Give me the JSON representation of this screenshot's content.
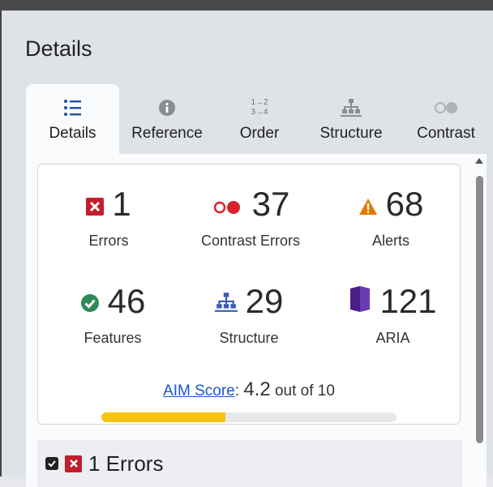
{
  "panel": {
    "title": "Details"
  },
  "tabs": [
    {
      "label": "Details",
      "icon": "list-icon",
      "active": true
    },
    {
      "label": "Reference",
      "icon": "info-icon",
      "active": false
    },
    {
      "label": "Order",
      "icon": "order-icon",
      "active": false
    },
    {
      "label": "Structure",
      "icon": "structure-icon",
      "active": false
    },
    {
      "label": "Contrast",
      "icon": "contrast-icon",
      "active": false
    }
  ],
  "order_icon_text": {
    "top": "1→2",
    "bottom": "3→4"
  },
  "stats": {
    "errors": {
      "value": "1",
      "label": "Errors",
      "icon": "error-icon",
      "color": "#c41d2b"
    },
    "contrast": {
      "value": "37",
      "label": "Contrast Errors",
      "icon": "contrast-error-icon",
      "color": "#d9222a"
    },
    "alerts": {
      "value": "68",
      "label": "Alerts",
      "icon": "alert-icon",
      "color": "#e07a00"
    },
    "features": {
      "value": "46",
      "label": "Features",
      "icon": "feature-icon",
      "color": "#2e8b57"
    },
    "structure": {
      "value": "29",
      "label": "Structure",
      "icon": "structure-icon",
      "color": "#3b5bb5"
    },
    "aria": {
      "value": "121",
      "label": "ARIA",
      "icon": "aria-icon",
      "color": "#4a1f8a"
    }
  },
  "score": {
    "link": "AIM Score",
    "sep": ":",
    "value": "4.2",
    "suffix": "out of 10",
    "progress": 0.42,
    "color": "#f6c310"
  },
  "section": {
    "label": "1 Errors",
    "checked": true
  }
}
